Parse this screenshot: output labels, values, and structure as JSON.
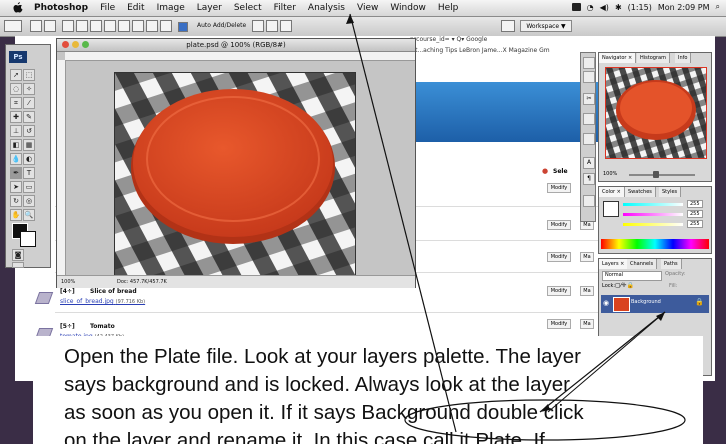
{
  "menubar": {
    "app_name": "Photoshop",
    "menus": [
      "File",
      "Edit",
      "Image",
      "Layer",
      "Select",
      "Filter",
      "Analysis",
      "View",
      "Window",
      "Help"
    ],
    "battery": "(1:15)",
    "clock": "Mon 2:09 PM"
  },
  "options_bar": {
    "auto_add_delete": "Auto Add/Delete",
    "workspace": "Workspace ▼"
  },
  "background_page": {
    "url_fragment": "prcourse_id= ▾  Q▾ Google",
    "bookmarks": "sket...aching Tips   LeBron Jame...X Magazine   Gm",
    "select_label": "Sele",
    "modify_label": "Modify",
    "ma_label": "Ma",
    "rows": [
      {
        "step": "4",
        "name": "Slice of bread",
        "file": "slice_of_bread.jpg",
        "size": "(97.716 Kb)"
      },
      {
        "step": "5",
        "name": "Tomato",
        "file": "tomato.jpg",
        "size": "(42.437 Kb)"
      }
    ]
  },
  "tools_panel": {
    "logo": "Ps"
  },
  "document": {
    "title": "plate.psd @ 100% (RGB/8#)",
    "zoom": "100%",
    "doc_size": "Doc: 457.7K/457.7K"
  },
  "panels": {
    "navigator_tabs": [
      "Navigator ×",
      "Histogram",
      "Info"
    ],
    "navigator_zoom": "100%",
    "color_tabs": [
      "Color ×",
      "Swatches",
      "Styles"
    ],
    "color_values": {
      "r": "255",
      "g": "255",
      "b": "255"
    },
    "layers_tabs": [
      "Layers ×",
      "Channels",
      "Paths"
    ],
    "blend_mode": "Normal",
    "opacity_label": "Opacity:",
    "lock_label": "Lock:",
    "fill_label": "Fill:",
    "layer_name": "Background"
  },
  "caption": {
    "lines": [
      "Open the Plate file.  Look at your layers palette.  The layer",
      "says background and is locked.  Always look at the layer",
      "as soon as you open it.  If it says Background double click",
      "on the layer and rename it.  In this case call it Plate.  If"
    ]
  },
  "colors": {
    "plate": "#d9431f",
    "plate_rim": "#e8582c",
    "check_dark": "#1e1e1e",
    "check_light": "#f4f4f4",
    "layer_selected": "#3d5b9c",
    "desktop": "#3a2d46"
  }
}
